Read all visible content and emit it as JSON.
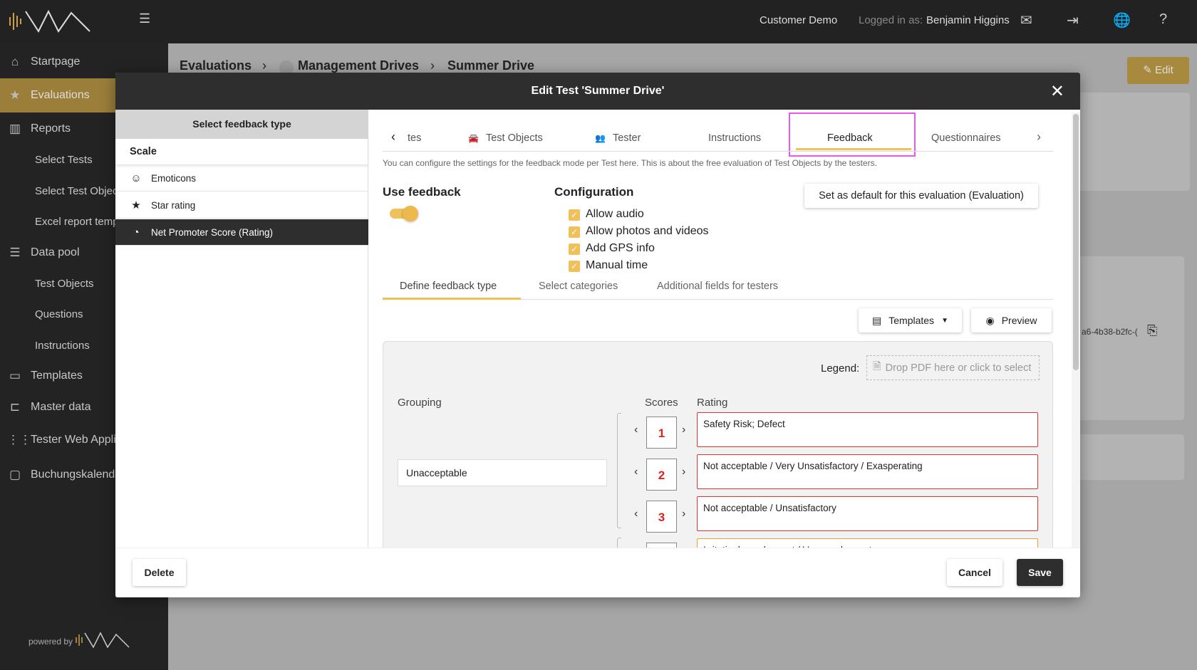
{
  "topbar": {
    "customer": "Customer Demo",
    "logged_in_label": "Logged in as:",
    "user": "Benjamin Higgins",
    "icons": [
      "mail-icon",
      "logout-icon",
      "globe-icon",
      "help-icon"
    ]
  },
  "sidebar": {
    "items": [
      {
        "label": "Startpage",
        "icon": "home-icon"
      },
      {
        "label": "Evaluations",
        "icon": "star-icon",
        "active": true
      },
      {
        "label": "Reports",
        "icon": "chart-icon"
      },
      {
        "label": "Select Tests",
        "sub": true
      },
      {
        "label": "Select Test Objec",
        "sub": true
      },
      {
        "label": "Excel report temp",
        "sub": true
      },
      {
        "label": "Data pool",
        "icon": "list-icon"
      },
      {
        "label": "Test Objects",
        "sub": true
      },
      {
        "label": "Questions",
        "sub": true
      },
      {
        "label": "Instructions",
        "sub": true
      },
      {
        "label": "Templates",
        "icon": "template-icon"
      },
      {
        "label": "Master data",
        "icon": "hierarchy-icon"
      },
      {
        "label": "Tester Web Applic",
        "icon": "grid-icon"
      },
      {
        "label": "Buchungskalender",
        "icon": "calendar-icon"
      }
    ],
    "powered_by": "powered by"
  },
  "page": {
    "breadcrumb": [
      "Evaluations",
      "Management Drives",
      "Summer Drive"
    ],
    "edit_label": "Edit",
    "id_fragment": "a6-4b38-b2fc-("
  },
  "modal": {
    "title": "Edit Test 'Summer Drive'",
    "left": {
      "header": "Select feedback type",
      "section": "Scale",
      "items": [
        {
          "label": "Emoticons",
          "icon": "smiley-icon"
        },
        {
          "label": "Star rating",
          "icon": "star-icon"
        },
        {
          "label": "Net Promoter Score (Rating)",
          "icon": "gauge-icon",
          "selected": true
        }
      ]
    },
    "tabs": [
      {
        "label": "tes"
      },
      {
        "label": "Test Objects"
      },
      {
        "label": "Tester"
      },
      {
        "label": "Instructions"
      },
      {
        "label": "Feedback",
        "active": true
      },
      {
        "label": "Questionnaires"
      }
    ],
    "description": "You can configure the settings for the feedback mode per Test here. This is about the free evaluation of Test Objects by the testers.",
    "use_feedback": {
      "label": "Use feedback",
      "on": true
    },
    "configuration": {
      "label": "Configuration",
      "options": [
        {
          "label": "Allow audio",
          "checked": true
        },
        {
          "label": "Allow photos and videos",
          "checked": true
        },
        {
          "label": "Add GPS info",
          "checked": true
        },
        {
          "label": "Manual time",
          "checked": true
        }
      ]
    },
    "default_button": "Set as default for this evaluation (Evaluation)",
    "subtabs": [
      {
        "label": "Define feedback type",
        "active": true
      },
      {
        "label": "Select categories"
      },
      {
        "label": "Additional fields for testers"
      }
    ],
    "templates_label": "Templates",
    "preview_label": "Preview",
    "legend_label": "Legend:",
    "drop_placeholder": "Drop PDF here or click to select",
    "headers": {
      "grouping": "Grouping",
      "scores": "Scores",
      "rating": "Rating"
    },
    "group": "Unacceptable",
    "rows": [
      {
        "score": "1",
        "rating": "Safety Risk; Defect"
      },
      {
        "score": "2",
        "rating": "Not acceptable / Very Unsatisfactory / Exasperating"
      },
      {
        "score": "3",
        "rating": "Not acceptable / Unsatisfactory"
      },
      {
        "score": "",
        "rating": "Irritatingly unpleasant / Very unpleasant"
      }
    ],
    "footer": {
      "delete": "Delete",
      "cancel": "Cancel",
      "save": "Save"
    }
  },
  "colors": {
    "accent": "#f0c05a",
    "dark": "#2e2e2e",
    "error": "#dd3333",
    "highlight": "#ee55ee"
  }
}
